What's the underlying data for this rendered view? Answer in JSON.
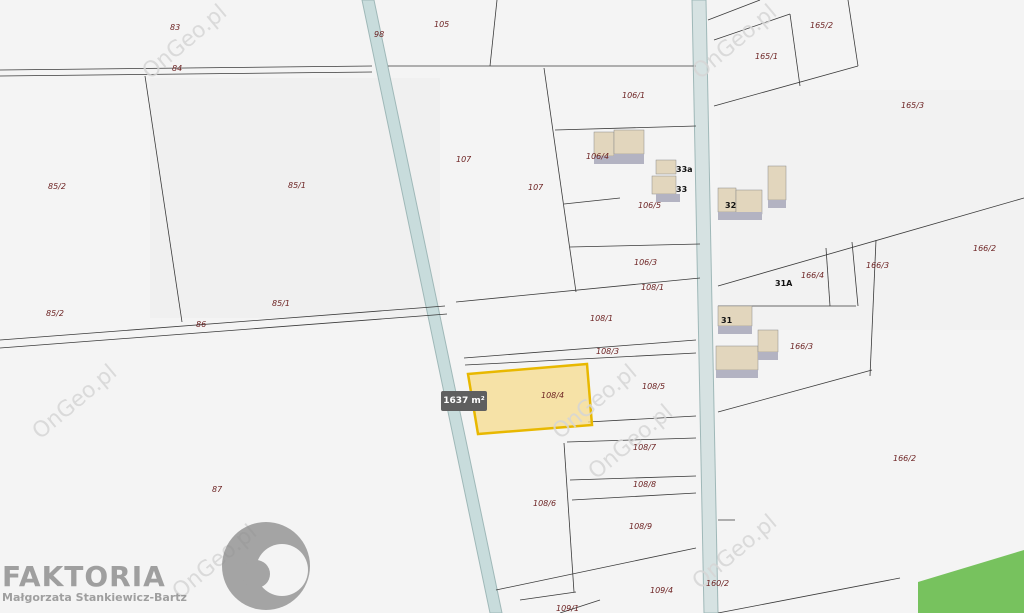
{
  "map": {
    "area_badge": "1637 m²",
    "parcels": {
      "p83": "83",
      "p84": "84",
      "p98": "98",
      "p105": "105",
      "p85_2a": "85/2",
      "p85_1a": "85/1",
      "p85_1b": "85/1",
      "p85_2b": "85/2",
      "p86": "86",
      "p87": "87",
      "p107a": "107",
      "p107b": "107",
      "p106_1": "106/1",
      "p106_4": "106/4",
      "p106_5": "106/5",
      "p106_3": "106/3",
      "p108_1a": "108/1",
      "p108_1b": "108/1",
      "p108_3": "108/3",
      "p108_4": "108/4",
      "p108_5": "108/5",
      "p108_7": "108/7",
      "p108_8": "108/8",
      "p108_6": "108/6",
      "p108_9": "108/9",
      "p109_4": "109/4",
      "p109_1": "109/1",
      "p160_2": "160/2",
      "p165_2": "165/2",
      "p165_1": "165/1",
      "p165_3": "165/3",
      "p166_4": "166/4",
      "p166_3a": "166/3",
      "p166_3b": "166/3",
      "p166_2a": "166/2",
      "p166_2b": "166/2"
    },
    "house_numbers": {
      "h33a": "33a",
      "h33": "33",
      "h32": "32",
      "h31a": "31A",
      "h31": "31"
    },
    "watermark": "OnGeo.pl",
    "colors": {
      "selected_fill": "#f7dc8e",
      "selected_stroke": "#e8b800",
      "road": "#c8dcdc",
      "building": "#e2d6bd",
      "green": "#77c25e"
    }
  },
  "brand": {
    "name": "FAKTORIA",
    "subtitle": "Małgorzata Stankiewicz-Bartz"
  }
}
